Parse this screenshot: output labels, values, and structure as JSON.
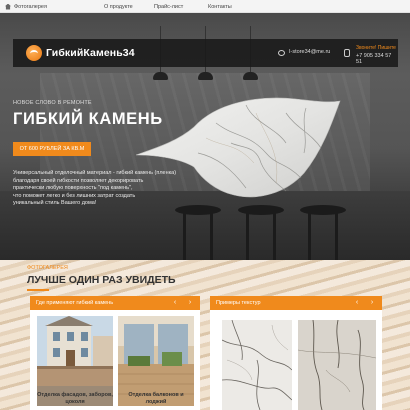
{
  "nav": {
    "items": [
      "Фотогалерея",
      "О продукте",
      "Прайс-лист",
      "Контакты"
    ]
  },
  "header": {
    "logo_text": "ГибкийКамень34",
    "email": "I-store34@me.ru",
    "call_label": "Звоните! Пишите",
    "phone": "+7 905 334 57 51"
  },
  "hero": {
    "kicker": "НОВОЕ СЛОВО В РЕМОНТЕ",
    "title": "ГИБКИЙ КАМЕНЬ",
    "price_button": "ОТ 600 РУБЛЕЙ ЗА КВ.М",
    "description_lines": [
      "Универсальный отделочный материал - гибкий камень (пленка)",
      "благодаря своей гибкости позволяет декорировать",
      "практически любую поверхность \"под камень\",",
      "что поможет легко и без лишних затрат создать",
      "уникальный стиль Вашего дома!"
    ]
  },
  "gallery": {
    "kicker": "ФОТОГАЛЕРЕЯ",
    "title": "ЛУЧШЕ ОДИН РАЗ УВИДЕТЬ",
    "left_card": {
      "title": "Где применяют гибкий камень",
      "captions": [
        [
          "Отделка фасадов, заборов,",
          "цоколя"
        ],
        [
          "Отделка балконов и лоджий"
        ]
      ]
    },
    "right_card": {
      "title": "Примеры текстур"
    },
    "prev_icon": "‹",
    "next_icon": "›"
  },
  "colors": {
    "accent": "#f08a1c",
    "header_bg": "#191919",
    "title_dark": "#333333"
  }
}
